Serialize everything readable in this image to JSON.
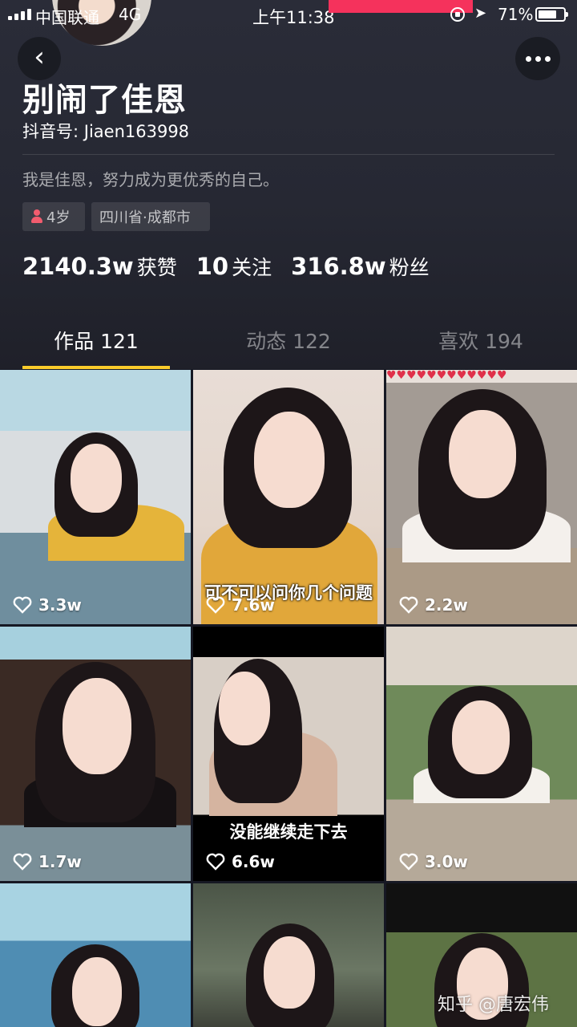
{
  "status_bar": {
    "carrier": "中国联通",
    "network": "4G",
    "time": "上午11:38",
    "battery": "71%"
  },
  "profile": {
    "nickname": "别闹了佳恩",
    "douyin_id": "抖音号: Jiaen163998",
    "bio": "我是佳恩，努力成为更优秀的自己。",
    "age_tag": "4岁",
    "location_tag": "四川省·成都市",
    "stats": [
      {
        "value": "2140.3w",
        "label": "获赞"
      },
      {
        "value": "10",
        "label": "关注"
      },
      {
        "value": "316.8w",
        "label": "粉丝"
      }
    ]
  },
  "tabs": [
    {
      "label": "作品 121",
      "active": true
    },
    {
      "label": "动态 122",
      "active": false
    },
    {
      "label": "喜欢 194",
      "active": false
    }
  ],
  "videos": [
    {
      "likes": "3.3w",
      "caption": ""
    },
    {
      "likes": "7.6w",
      "caption": "可不可以问你几个问题"
    },
    {
      "likes": "2.2w",
      "caption": ""
    },
    {
      "likes": "1.7w",
      "caption": ""
    },
    {
      "likes": "6.6w",
      "caption": "没能继续走下去"
    },
    {
      "likes": "3.0w",
      "caption": ""
    },
    {
      "likes": "",
      "caption": ""
    },
    {
      "likes": "",
      "caption": ""
    },
    {
      "likes": "",
      "caption": ""
    }
  ],
  "watermark": "知乎 @唐宏伟",
  "colors": {
    "background": "#161823",
    "tab_indicator": "#facc2b",
    "recording_bar": "#f5325c"
  },
  "icons": [
    "back-arrow-icon",
    "more-dots-icon",
    "heart-icon",
    "gender-female-icon",
    "location-arrow-icon",
    "lock-rotation-icon",
    "battery-icon",
    "signal-icon"
  ]
}
